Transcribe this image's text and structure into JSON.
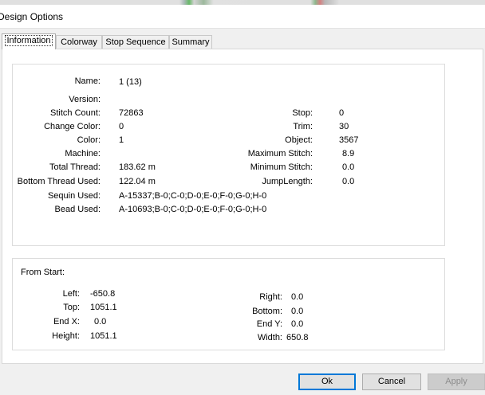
{
  "window": {
    "title": "Design Options"
  },
  "tabs": [
    {
      "label": "Information",
      "active": true
    },
    {
      "label": "Colorway",
      "active": false
    },
    {
      "label": "Stop Sequence",
      "active": false
    },
    {
      "label": "Summary",
      "active": false
    }
  ],
  "info": {
    "name": {
      "label": "Name:",
      "value": "1 (13)"
    },
    "version": {
      "label": "Version:",
      "value": ""
    },
    "stitch_count": {
      "label": "Stitch Count:",
      "value": "72863"
    },
    "change_color": {
      "label": "Change Color:",
      "value": "0"
    },
    "color": {
      "label": "Color:",
      "value": "1"
    },
    "machine": {
      "label": "Machine:",
      "value": ""
    },
    "total_thread": {
      "label": "Total Thread:",
      "value": "183.62 m"
    },
    "bottom_thread": {
      "label": "Bottom Thread Used:",
      "value": "122.04 m"
    },
    "sequin_used": {
      "label": "Sequin Used:",
      "value": "A-15337;B-0;C-0;D-0;E-0;F-0;G-0;H-0"
    },
    "bead_used": {
      "label": "Bead Used:",
      "value": "A-10693;B-0;C-0;D-0;E-0;F-0;G-0;H-0"
    },
    "stop": {
      "label": "Stop:",
      "value": "0"
    },
    "trim": {
      "label": "Trim:",
      "value": "30"
    },
    "object": {
      "label": "Object:",
      "value": "3567"
    },
    "max_stitch": {
      "label": "Maximum Stitch:",
      "value": "8.9"
    },
    "min_stitch": {
      "label": "Minimum Stitch:",
      "value": "0.0"
    },
    "jump_length": {
      "label": "JumpLength:",
      "value": "0.0"
    }
  },
  "from_start": {
    "heading": "From Start:",
    "left": {
      "label": "Left:",
      "value": "-650.8"
    },
    "top": {
      "label": "Top:",
      "value": "1051.1"
    },
    "end_x": {
      "label": "End X:",
      "value": "0.0"
    },
    "height": {
      "label": "Height:",
      "value": "1051.1"
    },
    "right": {
      "label": "Right:",
      "value": "0.0"
    },
    "bottom": {
      "label": "Bottom:",
      "value": "0.0"
    },
    "end_y": {
      "label": "End Y:",
      "value": "0.0"
    },
    "width": {
      "label": "Width:",
      "value": "650.8"
    }
  },
  "buttons": {
    "ok": "Ok",
    "cancel": "Cancel",
    "apply": "Apply"
  },
  "colors": {
    "accent": "#0078d7",
    "panel_bg": "#ffffff",
    "window_bg": "#f0f0f0"
  }
}
